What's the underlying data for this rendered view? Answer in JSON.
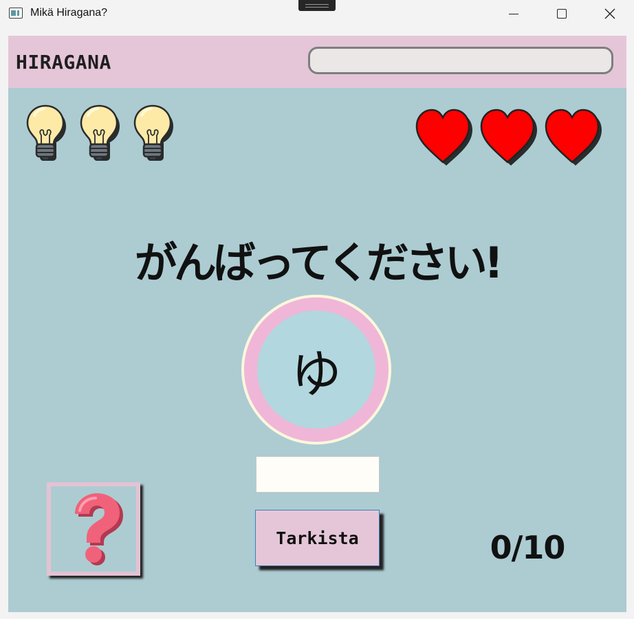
{
  "window": {
    "title": "Mikä Hiragana?",
    "controls": [
      "minimize",
      "maximize",
      "close"
    ]
  },
  "header": {
    "app_name": "HIRAGANA",
    "progress_fraction": 0
  },
  "hints": {
    "remaining": 3,
    "icon": "lightbulb-icon"
  },
  "lives": {
    "remaining": 3,
    "icon": "heart-icon",
    "color": "#ff0000"
  },
  "main": {
    "encouragement": "がんばってください!",
    "kana": "ゆ",
    "answer": {
      "value": "",
      "placeholder": ""
    },
    "check_label": "Tarkista",
    "help_icon": "question-mark-icon",
    "score": "0/10"
  },
  "colors": {
    "header_bg": "#e5c6d8",
    "main_bg": "#acccd2",
    "kana_ring": "#efb6d8",
    "kana_fill": "#b2d7df",
    "question_mark": "#f0627a"
  }
}
